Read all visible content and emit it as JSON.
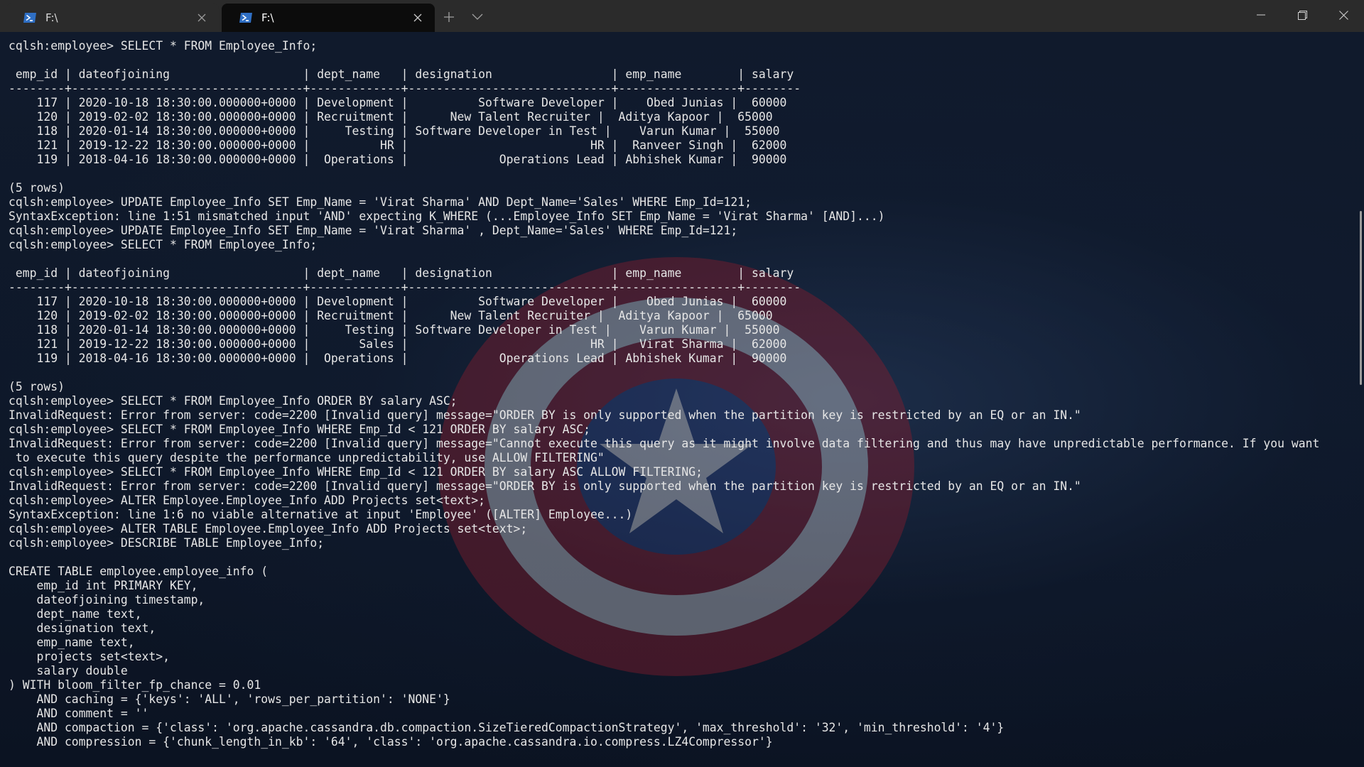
{
  "tabs": [
    {
      "title": "F:\\"
    },
    {
      "title": "F:\\"
    }
  ],
  "icons": {
    "tab_icon": "powershell-icon",
    "new_tab": "plus-icon",
    "dropdown": "chevron-down-icon",
    "minimize": "minimize-icon",
    "maximize": "restore-icon",
    "close": "close-icon"
  },
  "colors": {
    "titlebar": "#2b2b2b",
    "active_tab": "#0c0c0c",
    "terminal_text": "#e6e6e6"
  },
  "terminal": {
    "lines": [
      "cqlsh:employee> SELECT * FROM Employee_Info;",
      "",
      " emp_id | dateofjoining                   | dept_name   | designation                 | emp_name        | salary",
      "--------+---------------------------------+-------------+-----------------------------+-----------------+--------",
      "    117 | 2020-10-18 18:30:00.000000+0000 | Development |          Software Developer |    Obed Junias |  60000",
      "    120 | 2019-02-02 18:30:00.000000+0000 | Recruitment |      New Talent Recruiter |  Aditya Kapoor |  65000",
      "    118 | 2020-01-14 18:30:00.000000+0000 |     Testing | Software Developer in Test |    Varun Kumar |  55000",
      "    121 | 2019-12-22 18:30:00.000000+0000 |          HR |                          HR |  Ranveer Singh |  62000",
      "    119 | 2018-04-16 18:30:00.000000+0000 |  Operations |             Operations Lead | Abhishek Kumar |  90000",
      "",
      "(5 rows)",
      "cqlsh:employee> UPDATE Employee_Info SET Emp_Name = 'Virat Sharma' AND Dept_Name='Sales' WHERE Emp_Id=121;",
      "SyntaxException: line 1:51 mismatched input 'AND' expecting K_WHERE (...Employee_Info SET Emp_Name = 'Virat Sharma' [AND]...)",
      "cqlsh:employee> UPDATE Employee_Info SET Emp_Name = 'Virat Sharma' , Dept_Name='Sales' WHERE Emp_Id=121;",
      "cqlsh:employee> SELECT * FROM Employee_Info;",
      "",
      " emp_id | dateofjoining                   | dept_name   | designation                 | emp_name        | salary",
      "--------+---------------------------------+-------------+-----------------------------+-----------------+--------",
      "    117 | 2020-10-18 18:30:00.000000+0000 | Development |          Software Developer |    Obed Junias |  60000",
      "    120 | 2019-02-02 18:30:00.000000+0000 | Recruitment |      New Talent Recruiter |  Aditya Kapoor |  65000",
      "    118 | 2020-01-14 18:30:00.000000+0000 |     Testing | Software Developer in Test |    Varun Kumar |  55000",
      "    121 | 2019-12-22 18:30:00.000000+0000 |       Sales |                          HR |   Virat Sharma |  62000",
      "    119 | 2018-04-16 18:30:00.000000+0000 |  Operations |             Operations Lead | Abhishek Kumar |  90000",
      "",
      "(5 rows)",
      "cqlsh:employee> SELECT * FROM Employee_Info ORDER BY salary ASC;",
      "InvalidRequest: Error from server: code=2200 [Invalid query] message=\"ORDER BY is only supported when the partition key is restricted by an EQ or an IN.\"",
      "cqlsh:employee> SELECT * FROM Employee_Info WHERE Emp_Id < 121 ORDER BY salary ASC;",
      "InvalidRequest: Error from server: code=2200 [Invalid query] message=\"Cannot execute this query as it might involve data filtering and thus may have unpredictable performance. If you want",
      " to execute this query despite the performance unpredictability, use ALLOW FILTERING\"",
      "cqlsh:employee> SELECT * FROM Employee_Info WHERE Emp_Id < 121 ORDER BY salary ASC ALLOW FILTERING;",
      "InvalidRequest: Error from server: code=2200 [Invalid query] message=\"ORDER BY is only supported when the partition key is restricted by an EQ or an IN.\"",
      "cqlsh:employee> ALTER Employee.Employee_Info ADD Projects set<text>;",
      "SyntaxException: line 1:6 no viable alternative at input 'Employee' ([ALTER] Employee...)",
      "cqlsh:employee> ALTER TABLE Employee.Employee_Info ADD Projects set<text>;",
      "cqlsh:employee> DESCRIBE TABLE Employee_Info;",
      "",
      "CREATE TABLE employee.employee_info (",
      "    emp_id int PRIMARY KEY,",
      "    dateofjoining timestamp,",
      "    dept_name text,",
      "    designation text,",
      "    emp_name text,",
      "    projects set<text>,",
      "    salary double",
      ") WITH bloom_filter_fp_chance = 0.01",
      "    AND caching = {'keys': 'ALL', 'rows_per_partition': 'NONE'}",
      "    AND comment = ''",
      "    AND compaction = {'class': 'org.apache.cassandra.db.compaction.SizeTieredCompactionStrategy', 'max_threshold': '32', 'min_threshold': '4'}",
      "    AND compression = {'chunk_length_in_kb': '64', 'class': 'org.apache.cassandra.io.compress.LZ4Compressor'}"
    ]
  }
}
